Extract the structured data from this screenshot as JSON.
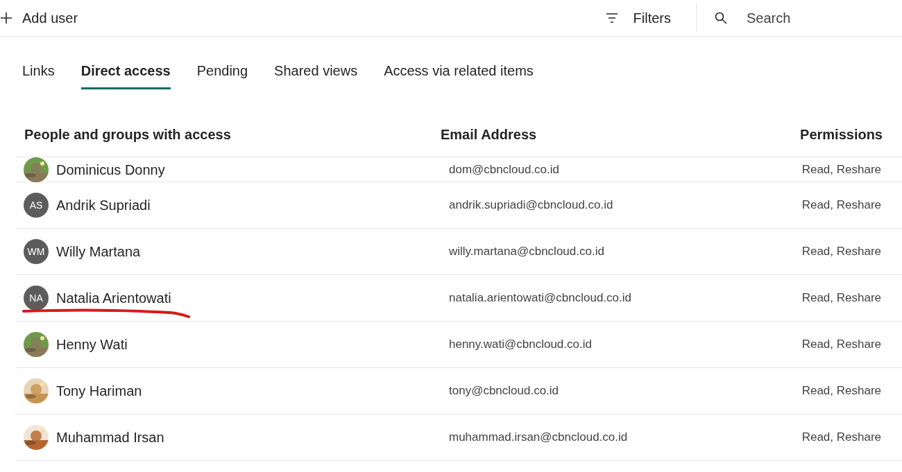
{
  "toolbar": {
    "add_label": "Add user",
    "filters_label": "Filters",
    "search": {
      "placeholder": "Search"
    }
  },
  "tabs": [
    {
      "label": "Links",
      "selected": false
    },
    {
      "label": "Direct access",
      "selected": true
    },
    {
      "label": "Pending",
      "selected": false
    },
    {
      "label": "Shared views",
      "selected": false
    },
    {
      "label": "Access via related items",
      "selected": false
    }
  ],
  "table": {
    "columns": [
      "People and groups with access",
      "Email Address",
      "Permissions"
    ],
    "rows": [
      {
        "name": "Dominicus Donny",
        "email": "dom@cbncloud.co.id",
        "permissions": "Read, Reshare",
        "partial": true
      },
      {
        "name": "Andrik Supriadi",
        "email": "andrik.supriadi@cbncloud.co.id",
        "permissions": "Read, Reshare",
        "avatar": {
          "kind": "initials",
          "text": "AS"
        }
      },
      {
        "name": "Willy Martana",
        "email": "willy.martana@cbncloud.co.id",
        "permissions": "Read, Reshare",
        "avatar": {
          "kind": "initials",
          "text": "WM"
        }
      },
      {
        "name": "Natalia Arientowati",
        "email": "natalia.arientowati@cbncloud.co.id",
        "permissions": "Read, Reshare",
        "avatar": {
          "kind": "initials",
          "text": "NA"
        },
        "annotated": true
      },
      {
        "name": "Henny Wati",
        "email": "henny.wati@cbncloud.co.id",
        "permissions": "Read, Reshare"
      },
      {
        "name": "Tony Hariman",
        "email": "tony@cbncloud.co.id",
        "permissions": "Read, Reshare"
      },
      {
        "name": "Muhammad Irsan",
        "email": "muhammad.irsan@cbncloud.co.id",
        "permissions": "Read, Reshare"
      }
    ]
  }
}
